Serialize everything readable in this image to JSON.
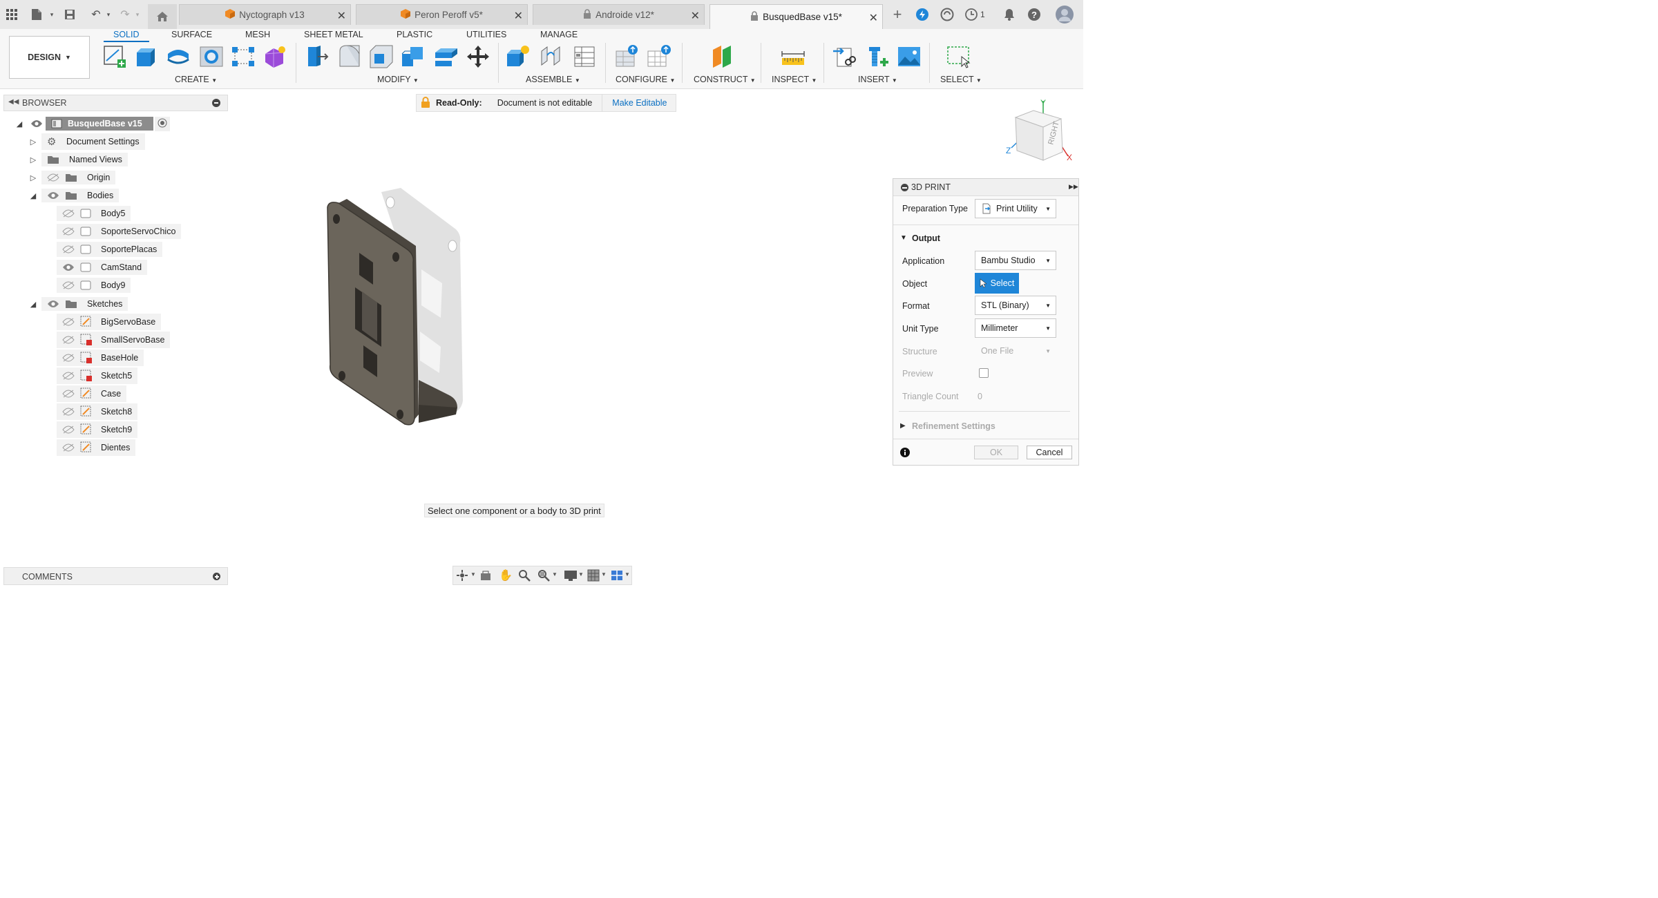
{
  "titlebar": {
    "tabs": [
      {
        "label": "Nyctograph v13",
        "icon": "box-icon"
      },
      {
        "label": "Peron Peroff v5*",
        "icon": "box-icon"
      },
      {
        "label": "Androide v12*",
        "icon": "lock-icon"
      },
      {
        "label": "BusquedBase v15*",
        "icon": "lock-icon"
      }
    ],
    "notification_count": "1"
  },
  "ribbon": {
    "tabs": [
      "SOLID",
      "SURFACE",
      "MESH",
      "SHEET METAL",
      "PLASTIC",
      "UTILITIES",
      "MANAGE"
    ],
    "active_tab": "SOLID",
    "workspace": "DESIGN",
    "groups": [
      "CREATE",
      "MODIFY",
      "ASSEMBLE",
      "CONFIGURE",
      "CONSTRUCT",
      "INSPECT",
      "INSERT",
      "SELECT"
    ]
  },
  "browser": {
    "title": "BROWSER",
    "root": "BusquedBase v15",
    "items": [
      {
        "label": "Document Settings",
        "kind": "settings"
      },
      {
        "label": "Named Views",
        "kind": "folder"
      },
      {
        "label": "Origin",
        "kind": "folder"
      },
      {
        "label": "Bodies",
        "kind": "folder"
      }
    ],
    "bodies": [
      "Body5",
      "SoporteServoChico",
      "SoportePlacas",
      "CamStand",
      "Body9"
    ],
    "sketches_label": "Sketches",
    "sketches": [
      "BigServoBase",
      "SmallServoBase",
      "BaseHole",
      "Sketch5",
      "Case",
      "Sketch8",
      "Sketch9",
      "Dientes"
    ]
  },
  "banner": {
    "readonly_label": "Read-Only:",
    "message": "Document is not editable",
    "action": "Make Editable"
  },
  "viewcube": {
    "face": "RIGHT",
    "axes": {
      "x": "X",
      "y": "Y",
      "z": "Z"
    }
  },
  "print_panel": {
    "title": "3D PRINT",
    "preparation_type_label": "Preparation Type",
    "preparation_type_value": "Print Utility",
    "output_label": "Output",
    "application_label": "Application",
    "application_value": "Bambu Studio",
    "object_label": "Object",
    "object_button": "Select",
    "format_label": "Format",
    "format_value": "STL (Binary)",
    "unit_type_label": "Unit Type",
    "unit_type_value": "Millimeter",
    "structure_label": "Structure",
    "structure_value": "One File",
    "preview_label": "Preview",
    "triangle_count_label": "Triangle Count",
    "triangle_count_value": "0",
    "refinement_label": "Refinement Settings",
    "ok_label": "OK",
    "cancel_label": "Cancel"
  },
  "prompt": "Select one component or a body to 3D print",
  "comments_label": "COMMENTS",
  "colors": {
    "accent": "#0a6fc2",
    "select_button": "#1f86d8",
    "model": "#6b655b",
    "ghost": "#d9d9d9"
  }
}
